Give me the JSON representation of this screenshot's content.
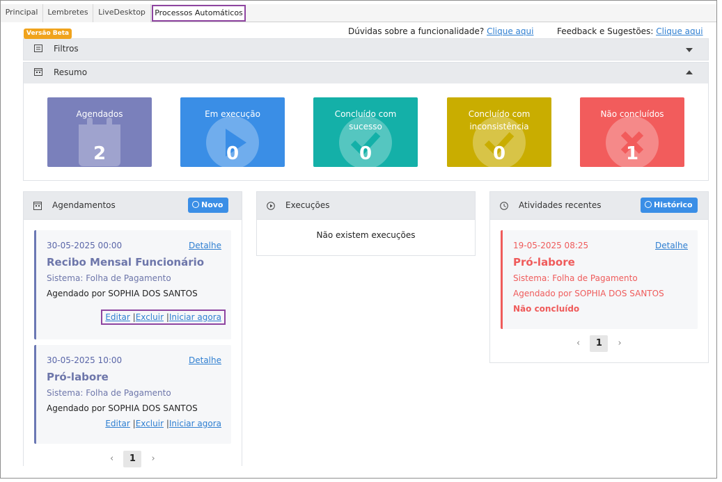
{
  "tabs": [
    {
      "label": "Principal"
    },
    {
      "label": "Lembretes"
    },
    {
      "label": "LiveDesktop"
    },
    {
      "label": "Processos Automáticos"
    }
  ],
  "beta_badge": "Versão Beta",
  "help": {
    "question": "Dúvidas sobre a funcionalidade?",
    "question_link": "Clique aqui",
    "feedback": "Feedback e Sugestões:",
    "feedback_link": "Clique aqui"
  },
  "filters": {
    "label": "Filtros"
  },
  "summary": {
    "label": "Resumo",
    "cards": [
      {
        "title": "Agendados",
        "value": "2",
        "color": "#7a80bb"
      },
      {
        "title": "Em execução",
        "value": "0",
        "color": "#3a8ee6"
      },
      {
        "title": "Concluído com sucesso",
        "value": "0",
        "color": "#14b0a8"
      },
      {
        "title": "Concluído com inconsistência",
        "value": "0",
        "color": "#c9ad00"
      },
      {
        "title": "Não concluídos",
        "value": "1",
        "color": "#f25c5c"
      }
    ]
  },
  "schedules": {
    "label": "Agendamentos",
    "new_button": "Novo",
    "items": [
      {
        "date": "30-05-2025 00:00",
        "detail": "Detalhe",
        "title": "Recibo Mensal Funcionário",
        "system": "Sistema: Folha de Pagamento",
        "scheduled_by": "Agendado por  SOPHIA DOS SANTOS",
        "edit": "Editar",
        "delete": "Excluir",
        "start": "Iniciar agora"
      },
      {
        "date": "30-05-2025 10:00",
        "detail": "Detalhe",
        "title": "Pró-labore",
        "system": "Sistema: Folha de Pagamento",
        "scheduled_by": "Agendado por SOPHIA DOS SANTOS",
        "edit": "Editar",
        "delete": "Excluir",
        "start": "Iniciar agora"
      }
    ],
    "page": "1"
  },
  "executions": {
    "label": "Execuções",
    "empty": "Não existem execuções"
  },
  "recent": {
    "label": "Atividades recentes",
    "history_button": "Histórico",
    "items": [
      {
        "date": "19-05-2025 08:25",
        "detail": "Detalhe",
        "title": "Pró-labore",
        "system": "Sistema: Folha de Pagamento",
        "scheduled_by": "Agendado por SOPHIA DOS SANTOS",
        "status": "Não concluído"
      }
    ],
    "page": "1"
  },
  "pager_prev": "‹",
  "pager_next": "›",
  "separator": "|"
}
